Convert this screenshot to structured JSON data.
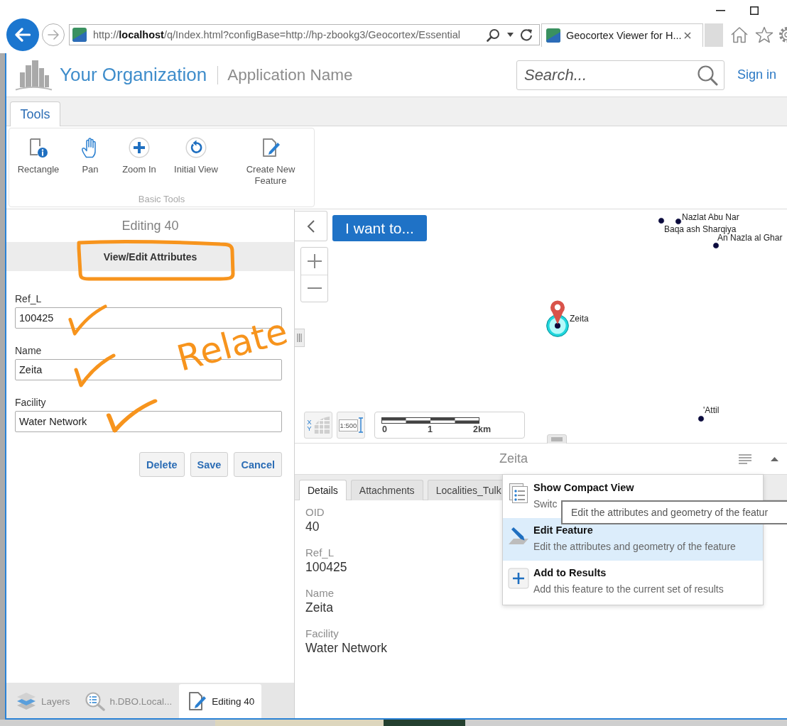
{
  "browser": {
    "url": "http://**localhost**/q/Index.html?configBase=http://hp-zbookg3/Geocortex/Essential",
    "tab_title": "Geocortex Viewer for H..."
  },
  "header": {
    "organization": "Your Organization",
    "application": "Application Name",
    "search": {
      "placeholder": "Search..."
    },
    "sign_in": "Sign in"
  },
  "ribbon": {
    "tabs": [
      {
        "label": "Tools",
        "selected": true
      }
    ],
    "groups": [
      {
        "title": "Basic Tools",
        "tools": [
          "Rectangle",
          "Pan",
          "Zoom In",
          "Initial View",
          "Create New Feature"
        ]
      }
    ]
  },
  "editor": {
    "title": "Editing 40",
    "section": {
      "label": "View/Edit Attributes",
      "circled": true
    },
    "fields": [
      {
        "label": "Ref_L",
        "value": "100425",
        "ticked": true
      },
      {
        "label": "Name",
        "value": "Zeita",
        "ticked": true
      },
      {
        "label": "Facility",
        "value": "Water Network",
        "ticked": true
      }
    ],
    "buttons": [
      "Delete",
      "Save",
      "Cancel"
    ],
    "handwritten_note": "Relate"
  },
  "panel_tabs": [
    {
      "label": "Layers",
      "selected": false
    },
    {
      "label": "h.DBO.Local...",
      "selected": false
    },
    {
      "label": "Editing 40",
      "selected": true
    }
  ],
  "map": {
    "button": "I want to...",
    "places": [
      {
        "name": "Nazlat Abu Nar",
        "selected": false
      },
      {
        "name": "Baqa ash Sharqiya",
        "selected": false
      },
      {
        "name": "An Nazla al Ghar",
        "selected": false
      },
      {
        "name": "Zeita",
        "selected": true
      },
      {
        "name": "'Attil",
        "selected": false
      }
    ],
    "coordinates_button": "XY",
    "scale_button": "1:500",
    "scale_labels": [
      "0",
      "1",
      "2km"
    ]
  },
  "details": {
    "title": "Zeita",
    "tabs": [
      {
        "label": "Details",
        "selected": true
      },
      {
        "label": "Attachments",
        "selected": false
      },
      {
        "label": "Localities_Tulk",
        "selected": false
      }
    ],
    "fields": [
      {
        "label": "OID",
        "value": "40"
      },
      {
        "label": "Ref_L",
        "value": "100425"
      },
      {
        "label": "Name",
        "value": "Zeita"
      },
      {
        "label": "Facility",
        "value": "Water Network"
      }
    ],
    "menu": {
      "items": [
        {
          "title": "Show Compact View",
          "subtitle": "Switc",
          "selected": false
        },
        {
          "title": "Edit Feature",
          "subtitle": "Edit the attributes and geometry of the feature",
          "selected": true
        },
        {
          "title": "Add to Results",
          "subtitle": "Add this feature to the current set of results",
          "selected": false
        }
      ],
      "tooltip": "Edit the attributes and geometry of the featur"
    }
  }
}
